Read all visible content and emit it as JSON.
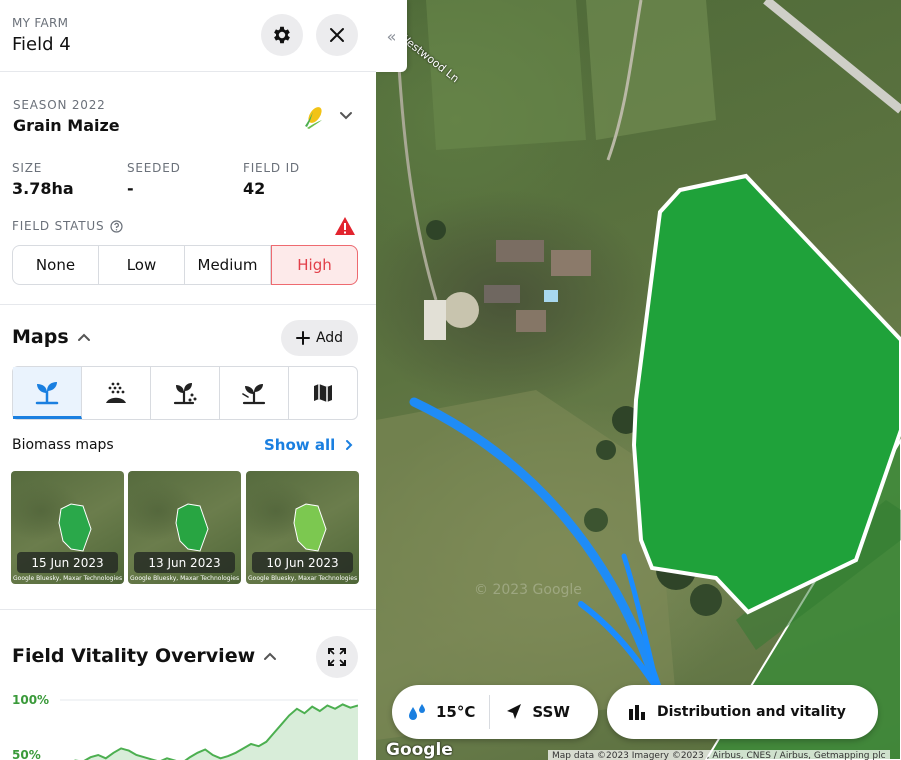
{
  "header": {
    "eyebrow": "MY FARM",
    "title": "Field 4"
  },
  "season": {
    "label": "SEASON 2022",
    "crop": "Grain Maize",
    "crop_icon": "corn-icon"
  },
  "stats": [
    {
      "label": "SIZE",
      "value": "3.78ha"
    },
    {
      "label": "SEEDED",
      "value": "-"
    },
    {
      "label": "FIELD ID",
      "value": "42"
    }
  ],
  "field_status": {
    "label": "FIELD STATUS",
    "options": [
      "None",
      "Low",
      "Medium",
      "High"
    ],
    "selected": "High"
  },
  "maps": {
    "title": "Maps",
    "add_label": "Add",
    "tabs": [
      {
        "icon": "seedling-icon",
        "active": true
      },
      {
        "icon": "seeding-icon",
        "active": false
      },
      {
        "icon": "fertilizer-plant-icon",
        "active": false
      },
      {
        "icon": "plant-care-icon",
        "active": false
      },
      {
        "icon": "map-icon",
        "active": false
      }
    ],
    "biomass_title": "Biomass maps",
    "show_all": "Show all",
    "thumbnails": [
      {
        "date": "15 Jun 2023",
        "credit": "Google Bluesky, Maxar Technologies"
      },
      {
        "date": "13 Jun 2023",
        "credit": "Google Bluesky, Maxar Technologies"
      },
      {
        "date": "10 Jun 2023",
        "credit": "Google Bluesky, Maxar Technologies"
      }
    ]
  },
  "vitality": {
    "title": "Field Vitality Overview",
    "chart_data": {
      "type": "area",
      "y_ticks": [
        "100%",
        "50%"
      ],
      "ylim": [
        0,
        100
      ],
      "values": [
        40,
        42,
        45,
        44,
        48,
        50,
        47,
        52,
        56,
        54,
        50,
        48,
        46,
        44,
        47,
        45,
        43,
        48,
        52,
        55,
        50,
        47,
        49,
        52,
        56,
        60,
        58,
        62,
        70,
        78,
        86,
        92,
        88,
        94,
        90,
        95,
        92,
        96,
        93,
        95
      ],
      "color": "#4caf50"
    }
  },
  "map": {
    "collapse_icon": "double-chevron-left-icon",
    "road_label": "Westwood Ln",
    "watermark": "© 2023 Google",
    "google_logo": "Google",
    "credits": "Map data ©2023 Imagery ©2023 , Airbus, CNES / Airbus, Getmapping plc",
    "weather": {
      "temperature": "15°C",
      "wind": "SSW"
    },
    "distribution_label": "Distribution and vitality",
    "field_color": "#1fa23a",
    "arrow_color": "#1a8cff"
  }
}
